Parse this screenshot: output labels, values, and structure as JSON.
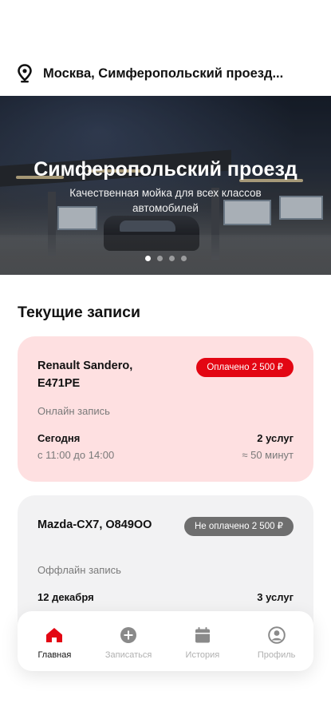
{
  "location": {
    "text": "Москва, Симферопольский проезд..."
  },
  "banner": {
    "title": "Симферопольский проезд",
    "subtitle": "Качественная мойка для всех классов автомобилей",
    "slide_count": 4,
    "active_slide": 1
  },
  "current_bookings": {
    "title": "Текущие записи",
    "items": [
      {
        "car_name": "Renault Sandero, Е471РЕ",
        "status": "Оплачено 2 500 ₽",
        "status_color": "#e30613",
        "booking_type": "Онлайн запись",
        "date": "Сегодня",
        "services": "2 услуг",
        "time": "с 11:00 до 14:00",
        "duration": "≈ 50 минут"
      },
      {
        "car_name": "Mazda-CX7, О849ОО",
        "status": "Не оплачено 2 500 ₽",
        "status_color": "#6e6e6e",
        "booking_type": "Оффлайн запись",
        "date": "12 декабря",
        "services": "3 услуг"
      }
    ]
  },
  "bottom_nav": {
    "active": "Главная",
    "accent_color": "#e30613",
    "items": [
      {
        "label": "Главная",
        "icon": "home-icon"
      },
      {
        "label": "Записаться",
        "icon": "plus-circle-icon"
      },
      {
        "label": "История",
        "icon": "calendar-icon"
      },
      {
        "label": "Профиль",
        "icon": "profile-icon"
      }
    ]
  }
}
